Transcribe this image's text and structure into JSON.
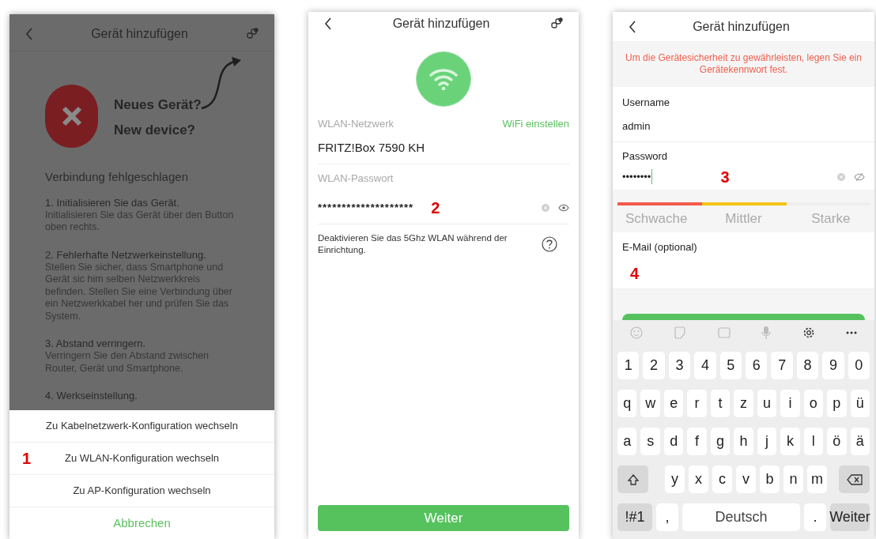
{
  "screens": [
    {
      "title": "Gerät hinzufügen",
      "hero": {
        "lines": [
          "Neues Gerät?",
          "New device?"
        ]
      },
      "heading": "Verbindung fehlgeschlagen",
      "steps": [
        {
          "title": "1. Initialisieren Sie das Gerät.",
          "text": "Initialisieren Sie das Gerät über den Button oben rechts."
        },
        {
          "title": "2. Fehlerhafte Netzwerkeinstellung.",
          "text": "Stellen Sie sicher, dass Smartphone und Gerät sic him selben Netzwerkkreis befinden. Stellen Sie eine Verbindung über ein Netzwerkkabel her und prüfen Sie das System."
        },
        {
          "title": "3. Abstand verringern.",
          "text": "Verringern Sie den Abstand zwischen Router, Gerät und Smartphone."
        },
        {
          "title": "4. Werkseinstellung."
        }
      ],
      "sheet": {
        "options": [
          "Zu Kabelnetzwerk-Konfiguration wechseln",
          "Zu WLAN-Konfiguration wechseln",
          "Zu AP-Konfiguration wechseln"
        ],
        "cancel": "Abbrechen"
      },
      "annotation": "1"
    },
    {
      "title": "Gerät hinzufügen",
      "network": {
        "label": "WLAN-Netzwerk",
        "link": "WiFi einstellen",
        "value": "FRITZ!Box 7590 KH"
      },
      "password": {
        "label": "WLAN-Passwort",
        "value": "********************"
      },
      "note": "Deaktivieren Sie das 5Ghz WLAN während der Einrichtung.",
      "button": "Weiter",
      "annotation": "2"
    },
    {
      "title": "Gerät hinzufügen",
      "warning": "Um die Gerätesicherheit zu gewährleisten, legen Sie ein Gerätekennwort fest.",
      "username": {
        "label": "Username",
        "value": "admin"
      },
      "password": {
        "label": "Password",
        "value": "••••••••"
      },
      "strength": {
        "level": 0.67,
        "labels": [
          "Schwache",
          "Mittler",
          "Starke"
        ]
      },
      "email": {
        "label": "E-Mail (optional)"
      },
      "annotations": [
        "3",
        "4"
      ],
      "keyboard": {
        "digits": [
          "1",
          "2",
          "3",
          "4",
          "5",
          "6",
          "7",
          "8",
          "9",
          "0"
        ],
        "rows": [
          [
            "q",
            "w",
            "e",
            "r",
            "t",
            "z",
            "u",
            "i",
            "o",
            "p",
            "ü"
          ],
          [
            "a",
            "s",
            "d",
            "f",
            "g",
            "h",
            "j",
            "k",
            "l",
            "ö",
            "ä"
          ]
        ],
        "bottom_letters": [
          "y",
          "x",
          "c",
          "v",
          "b",
          "n",
          "m"
        ],
        "space": "Deutsch",
        "symbols": "!#1",
        "comma": ",",
        "period": ".",
        "action": "Weiter"
      }
    }
  ]
}
